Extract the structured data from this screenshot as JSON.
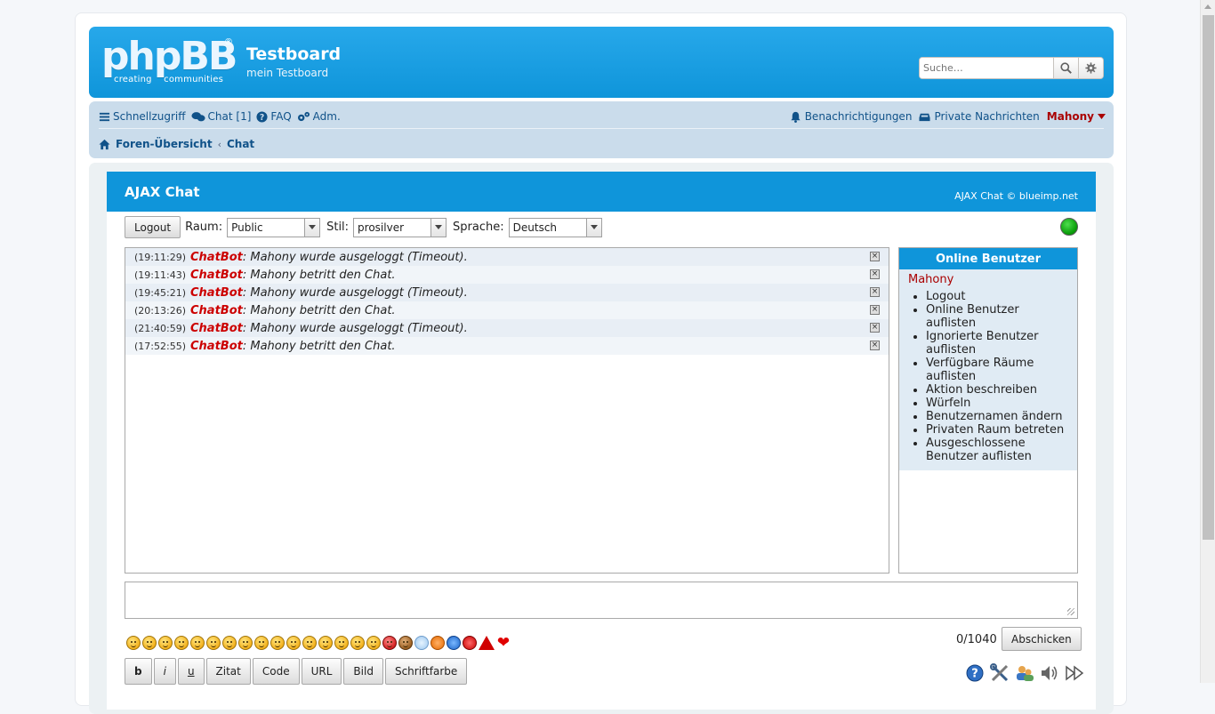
{
  "header": {
    "logo_text": "phpBB",
    "logo_tagline": "creating    communities",
    "site_title": "Testboard",
    "site_description": "mein Testboard",
    "search_placeholder": "Suche…"
  },
  "nav": {
    "quick_links": "Schnellzugriff",
    "chat": "Chat [1]",
    "faq": "FAQ",
    "adm": "Adm.",
    "notifications": "Benachrichtigungen",
    "private_messages": "Private Nachrichten",
    "username": "Mahony"
  },
  "breadcrumb": {
    "home": "Foren-Übersicht",
    "current": "Chat"
  },
  "chat": {
    "title": "AJAX Chat",
    "copyright": "AJAX Chat © blueimp.net",
    "logout_button": "Logout",
    "room_label": "Raum:",
    "room_value": "Public",
    "style_label": "Stil:",
    "style_value": "prosilver",
    "language_label": "Sprache:",
    "language_value": "Deutsch",
    "messages": [
      {
        "time": "(19:11:29)",
        "user": "ChatBot",
        "text": ": Mahony wurde ausgeloggt (Timeout)."
      },
      {
        "time": "(19:11:43)",
        "user": "ChatBot",
        "text": ": Mahony betritt den Chat."
      },
      {
        "time": "(19:45:21)",
        "user": "ChatBot",
        "text": ": Mahony wurde ausgeloggt (Timeout)."
      },
      {
        "time": "(20:13:26)",
        "user": "ChatBot",
        "text": ": Mahony betritt den Chat."
      },
      {
        "time": "(21:40:59)",
        "user": "ChatBot",
        "text": ": Mahony wurde ausgeloggt (Timeout)."
      },
      {
        "time": "(17:52:55)",
        "user": "ChatBot",
        "text": ": Mahony betritt den Chat."
      }
    ],
    "online": {
      "title": "Online Benutzer",
      "user": "Mahony",
      "menu": [
        "Logout",
        "Online Benutzer auflisten",
        "Ignorierte Benutzer auflisten",
        "Verfügbare Räume auflisten",
        "Aktion beschreiben",
        "Würfeln",
        "Benutzernamen ändern",
        "Privaten Raum betreten",
        "Ausgeschlossene Benutzer auflisten"
      ]
    },
    "counter": "0/1040",
    "send_button": "Abschicken",
    "bbcode": {
      "bold": "b",
      "italic": "i",
      "underline": "u",
      "quote": "Zitat",
      "code": "Code",
      "url": "URL",
      "image": "Bild",
      "color": "Schriftfarbe"
    },
    "emoticons": [
      "smile-icon",
      "sad-icon",
      "wink-icon",
      "tongue-icon",
      "grin-icon",
      "neutral-icon",
      "surprised-icon",
      "hmm-icon",
      "nerd-icon",
      "glasses-icon",
      "cool-icon",
      "laugh-icon",
      "cry-icon",
      "angry-icon",
      "blush-icon",
      "kiss-icon",
      "devil-icon",
      "monkey-icon",
      "bulb-icon",
      "exclamation-icon",
      "question-icon",
      "stop-icon",
      "warning-icon",
      "heart-icon"
    ]
  },
  "colors": {
    "header_blue": "#0f95da",
    "nav_bg": "#cadceb",
    "link": "#105289",
    "username_red": "#aa0000",
    "bot_red": "#cc0000",
    "status_green": "#0a9d0a"
  }
}
